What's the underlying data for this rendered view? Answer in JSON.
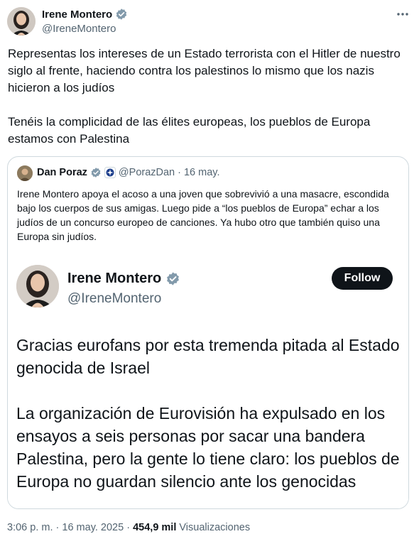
{
  "author": {
    "name": "Irene Montero",
    "handle": "@IreneMontero",
    "avatar_icon": "profile-photo-icon",
    "verified_icon": "verified-badge-icon"
  },
  "more_icon": "more-options-icon",
  "body": "Representas los intereses de un Estado terrorista con el Hitler de nuestro siglo al frente, haciendo contra los palestinos lo mismo que los nazis hicieron a los judíos\n\nTenéis la complicidad de las élites europeas, los pueblos de Europa estamos con Palestina",
  "quote": {
    "name": "Dan Poraz",
    "handle": "@PorazDan",
    "separator": "·",
    "date": "16 may.",
    "text": "Irene Montero apoya el acoso a una joven que sobrevivió a una masacre, escondida bajo los cuerpos de sus amigas. Luego pide a “los pueblos de Europa” echar a los judíos de un concurso europeo de canciones. Ya hubo otro que también quiso una Europa sin judíos.",
    "screenshot": {
      "name": "Irene Montero",
      "handle": "@IreneMontero",
      "follow_label": "Follow",
      "paragraph1": "Gracias eurofans por esta tremenda pitada al Estado genocida de Israel",
      "paragraph2": "La organización de Eurovisión ha expulsado en los ensayos a seis personas por sacar una bandera Palestina, pero la gente lo tiene claro: los pueblos de Europa no guardan silencio ante los genocidas"
    }
  },
  "meta": {
    "time": "3:06 p. m.",
    "dot": "·",
    "date": "16 may. 2025",
    "views_count": "454,9 mil",
    "views_label": "Visualizaciones"
  }
}
